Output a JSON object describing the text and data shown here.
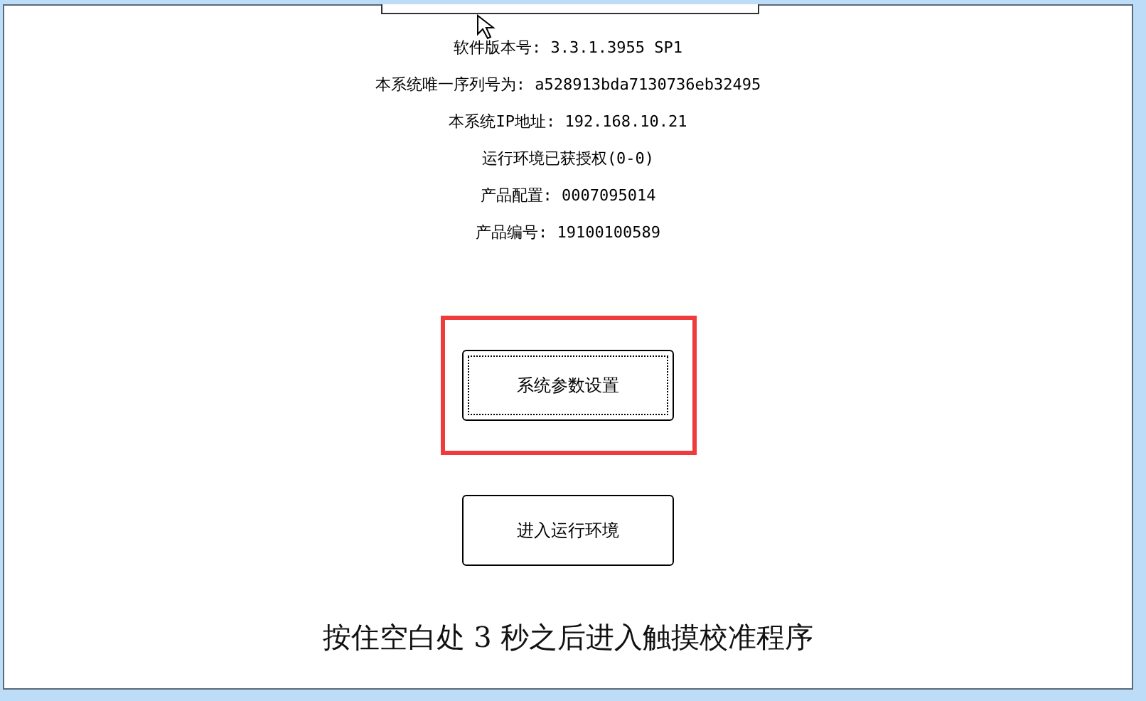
{
  "info_lines": [
    "软件版本号: 3.3.1.3955 SP1",
    "本系统唯一序列号为: a528913bda7130736eb32495",
    "本系统IP地址: 192.168.10.21",
    "运行环境已获授权(0-0)",
    "产品配置: 0007095014",
    "产品编号: 19100100589"
  ],
  "buttons": [
    {
      "label": "系统参数设置",
      "focused": true,
      "highlighted": true
    },
    {
      "label": "进入运行环境",
      "focused": false,
      "highlighted": false
    }
  ],
  "hint": "按住空白处 3 秒之后进入触摸校准程序"
}
